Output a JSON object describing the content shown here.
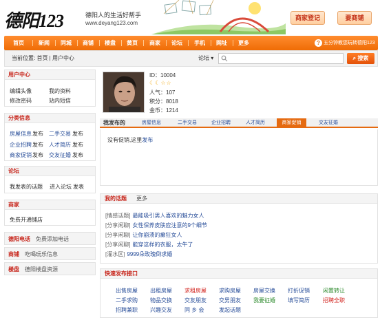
{
  "header": {
    "logo": "德阳123",
    "slogan": "德阳人的生活好帮手",
    "site_url": "www.deyang123.com",
    "register_button": "商家登记",
    "recruit_button": "要商铺"
  },
  "nav": {
    "items": [
      "首页",
      "新闻",
      "同城",
      "商铺",
      "楼盘",
      "黄页",
      "商家",
      "论坛",
      "手机",
      "网址",
      "更多"
    ],
    "game_badge": "?",
    "game_link": "五分钟教您玩转德阳123"
  },
  "search": {
    "breadcrumb": "当前位置: 首页 | 用户中心",
    "scope": "论坛 ▾",
    "placeholder": "",
    "button": "搜索"
  },
  "sidebar": {
    "user_center": {
      "title": "用户中心",
      "links": [
        "编辑头像",
        "我的资料",
        "修改密码",
        "站内短信"
      ]
    },
    "classifieds": {
      "title": "分类信息",
      "rows": [
        [
          "房屋信息",
          "发布",
          "二手交易",
          "发布"
        ],
        [
          "企业招聘",
          "发布",
          "人才简历",
          "发布"
        ],
        [
          "商家促销",
          "发布",
          "交友征婚",
          "发布"
        ]
      ]
    },
    "forum": {
      "title": "论坛",
      "links": [
        "我发表的话题",
        "进入论坛",
        "发表"
      ]
    },
    "merchant": {
      "title": "商家",
      "link": "免费开通铺店"
    },
    "rows": [
      {
        "key": "德阳电话",
        "value": "免费添加电话"
      },
      {
        "key": "商铺",
        "value": "吃喝玩乐信息"
      },
      {
        "key": "楼盘",
        "value": "德阳楼盘资源"
      }
    ]
  },
  "profile": {
    "id": "ID：10004",
    "badges": "☾☾☆☆",
    "popularity": "人气：107",
    "points": "积分：8018",
    "gold": "金币：1214"
  },
  "tabs": {
    "mine": "我发布的",
    "items": [
      "房屋信息",
      "二手交易",
      "企业招聘",
      "人才简历",
      "商家促销",
      "交友征婚"
    ],
    "active_index": 4,
    "empty_message": "没有促销,这里",
    "post_link": "发布"
  },
  "topics": {
    "title": "我的话题",
    "more": "更多",
    "items": [
      {
        "tag": "[情感话题]",
        "title": "最能吸引男人喜欢的魅力女人"
      },
      {
        "tag": "[分享闲聊]",
        "title": "女性保养皮肤应注意的9个细节"
      },
      {
        "tag": "[分享闲聊]",
        "title": "让你崩溃的癫狂女人"
      },
      {
        "tag": "[分享闲聊]",
        "title": "能穿这样的衣服，太牛了"
      },
      {
        "tag": "[灌水区]",
        "title": "9999朵玫瑰倒求婚"
      }
    ]
  },
  "quick_post": {
    "title": "快速发布接口",
    "rows": [
      [
        {
          "label": "出售房屋",
          "color": "#2a4f9a"
        },
        {
          "label": "出租房屋",
          "color": "#2a4f9a"
        },
        {
          "label": "求租房屋",
          "color": "#d2221c"
        },
        {
          "label": "求购房屋",
          "color": "#2a4f9a"
        },
        {
          "label": "房屋交换",
          "color": "#2a4f9a"
        },
        {
          "label": "打折促销",
          "color": "#2a4f9a"
        },
        {
          "label": "闲置转让",
          "color": "#2c8a2c"
        }
      ],
      [
        {
          "label": "二手求购",
          "color": "#2a4f9a"
        },
        {
          "label": "物品交换",
          "color": "#2a4f9a"
        },
        {
          "label": "交友朋友",
          "color": "#2a4f9a"
        },
        {
          "label": "交男朋友",
          "color": "#2a4f9a"
        },
        {
          "label": "我要征婚",
          "color": "#2c8a2c"
        },
        {
          "label": "填写简历",
          "color": "#2a4f9a"
        },
        {
          "label": "招聘全职",
          "color": "#d2221c"
        }
      ],
      [
        {
          "label": "招聘兼职",
          "color": "#2a4f9a"
        },
        {
          "label": "兴趣交友",
          "color": "#2a4f9a"
        },
        {
          "label": "同 乡 会",
          "color": "#2a4f9a"
        },
        {
          "label": "发起话题",
          "color": "#2a4f9a"
        }
      ]
    ]
  }
}
